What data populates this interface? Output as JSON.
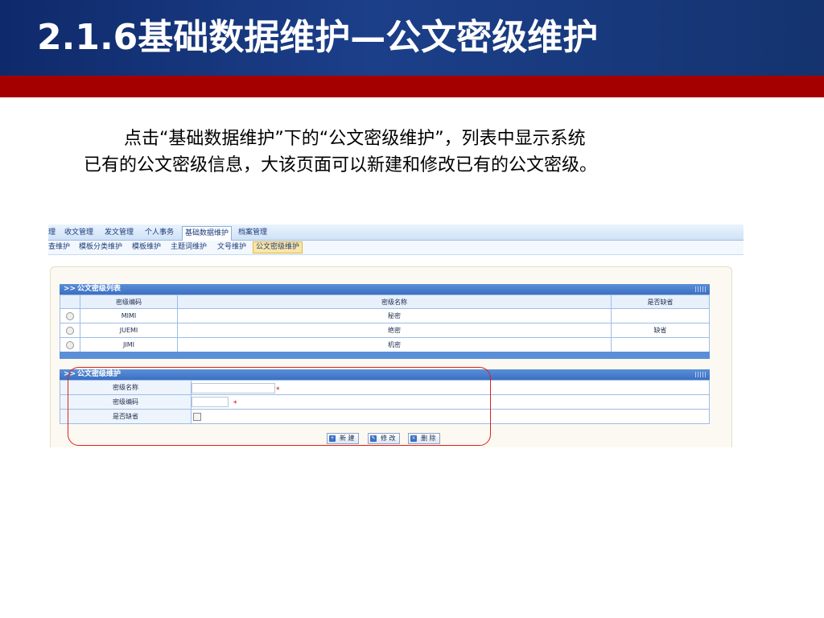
{
  "slide": {
    "title_num": "2.1.6",
    "title_text": "基础数据维护",
    "title_sep": "—",
    "title_sub": "公文密级维护",
    "desc_line1": "点击“基础数据维护”下的“公文密级维护”，列表中显示系统",
    "desc_line2": "已有的公文密级信息，大该页面可以新建和修改已有的公文密级。"
  },
  "colors": {
    "header": "#1c3f8a",
    "redbar": "#a50000",
    "panel": "#3b6fc2",
    "highlight": "#e02020"
  },
  "nav": {
    "tabs": [
      "理",
      "收文管理",
      "发文管理",
      "个人事务",
      "基础数据维护",
      "档案管理"
    ],
    "active_tab": "基础数据维护",
    "subtabs": [
      "查维护",
      "模板分类维护",
      "模板维护",
      "主题词维护",
      "文号维护",
      "公文密级维护"
    ],
    "active_subtab": "公文密级维护"
  },
  "list_panel": {
    "title": "公文密级列表",
    "columns": [
      "密级编码",
      "密级名称",
      "是否缺省"
    ],
    "rows": [
      {
        "code": "MIMI",
        "name": "秘密",
        "default": ""
      },
      {
        "code": "JUEMI",
        "name": "绝密",
        "default": "缺省"
      },
      {
        "code": "JIMI",
        "name": "机密",
        "default": ""
      }
    ]
  },
  "form_panel": {
    "title": "公文密级维护",
    "fields": [
      {
        "label": "密级名称",
        "required": "*"
      },
      {
        "label": "密级编码",
        "required": "*"
      },
      {
        "label": "是否缺省",
        "required": ""
      }
    ]
  },
  "buttons": {
    "new": "新 建",
    "edit": "修 改",
    "delete": "删 除"
  }
}
